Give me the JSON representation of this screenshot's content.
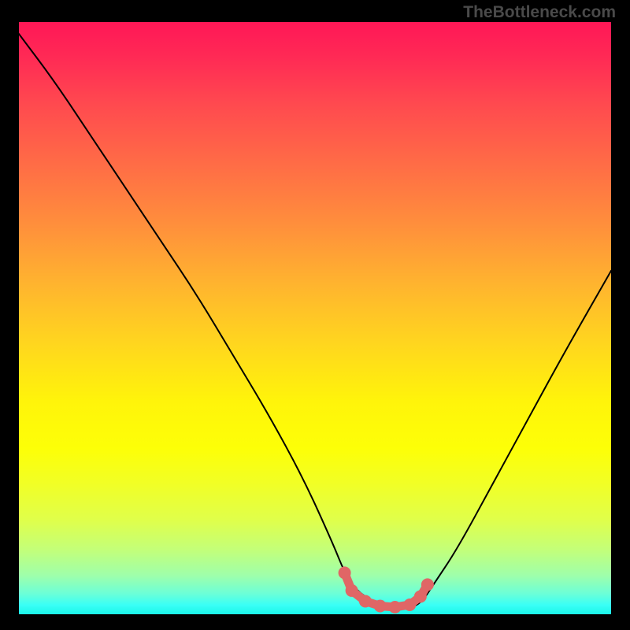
{
  "watermark": "TheBottleneck.com",
  "chart_data": {
    "type": "line",
    "title": "",
    "xlabel": "",
    "ylabel": "",
    "xlim": [
      0,
      100
    ],
    "ylim": [
      0,
      100
    ],
    "series": [
      {
        "name": "bottleneck-curve",
        "x": [
          0,
          6,
          12,
          18,
          24,
          30,
          36,
          42,
          48,
          53,
          55,
          57,
          60,
          63,
          66,
          68,
          70,
          74,
          80,
          86,
          92,
          100
        ],
        "values": [
          98,
          90,
          81,
          72,
          63,
          54,
          44,
          34,
          23,
          12,
          7,
          4,
          2,
          1,
          1,
          2,
          5,
          11,
          22,
          33,
          44,
          58
        ]
      },
      {
        "name": "dot-markers",
        "x": [
          55.0,
          56.2,
          58.5,
          61.0,
          63.5,
          66.0,
          67.8,
          69.0
        ],
        "values": [
          7.0,
          4.0,
          2.2,
          1.4,
          1.2,
          1.6,
          3.0,
          5.0
        ]
      }
    ],
    "annotations": [],
    "gradient_stops": [
      {
        "pos": 0.0,
        "color": "#ff1756"
      },
      {
        "pos": 0.5,
        "color": "#ffd51f"
      },
      {
        "pos": 0.72,
        "color": "#fdff07"
      },
      {
        "pos": 1.0,
        "color": "#1bf5e8"
      }
    ]
  }
}
